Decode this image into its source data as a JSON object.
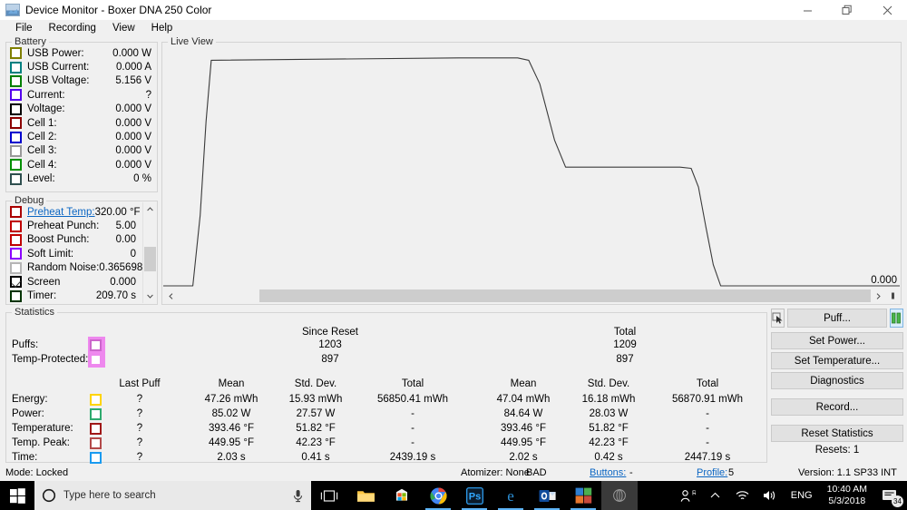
{
  "window": {
    "title": "Device Monitor - Boxer DNA 250 Color",
    "icon": "chart-app-icon",
    "controls": [
      {
        "name": "minimize",
        "glyph": "minimize-icon"
      },
      {
        "name": "maximize",
        "glyph": "restore-icon"
      },
      {
        "name": "close",
        "glyph": "close-icon"
      }
    ]
  },
  "menu": {
    "items": [
      "File",
      "Recording",
      "View",
      "Help"
    ]
  },
  "battery": {
    "legend": "Battery",
    "rows": [
      {
        "label": "USB Power:",
        "value": "0.000 W",
        "color": "#7f7f00",
        "checked": false
      },
      {
        "label": "USB Current:",
        "value": "0.000 A",
        "color": "#008080",
        "checked": false
      },
      {
        "label": "USB Voltage:",
        "value": "5.156 V",
        "color": "#008000",
        "checked": false
      },
      {
        "label": "Current:",
        "value": "?",
        "color": "#5500ee",
        "checked": false
      },
      {
        "label": "Voltage:",
        "value": "0.000 V",
        "color": "#000000",
        "checked": false
      },
      {
        "label": "Cell 1:",
        "value": "0.000 V",
        "color": "#8b0000",
        "checked": false
      },
      {
        "label": "Cell 2:",
        "value": "0.000 V",
        "color": "#0000cd",
        "checked": false
      },
      {
        "label": "Cell 3:",
        "value": "0.000 V",
        "color": "#9a9a9a",
        "checked": false
      },
      {
        "label": "Cell 4:",
        "value": "0.000 V",
        "color": "#009000",
        "checked": false
      },
      {
        "label": "Level:",
        "value": "0 %",
        "color": "#2f4f4f",
        "checked": false
      }
    ]
  },
  "debug": {
    "legend": "Debug",
    "rows": [
      {
        "label": "Preheat Temp:",
        "value": "320.00 °F",
        "color": "#aa0000",
        "checked": false,
        "link": true
      },
      {
        "label": "Preheat Punch:",
        "value": "5.00",
        "color": "#c00000",
        "checked": false,
        "link": false
      },
      {
        "label": "Boost Punch:",
        "value": "0.00",
        "color": "#c00000",
        "checked": false,
        "link": false
      },
      {
        "label": "Soft Limit:",
        "value": "0",
        "color": "#8b00ff",
        "checked": false,
        "link": false
      },
      {
        "label": "Random Noise:",
        "value": "0.365698",
        "color": "#b5b5b5",
        "checked": false,
        "link": false
      },
      {
        "label": "Screen",
        "value": "0.000",
        "color": "#000000",
        "checked": true,
        "link": false
      },
      {
        "label": "Timer:",
        "value": "209.70 s",
        "color": "#003300",
        "checked": false,
        "link": false
      }
    ],
    "scroll": {
      "up": "▲",
      "down": "▼"
    }
  },
  "liveview": {
    "legend": "Live View",
    "last_value": "0.000",
    "scroll": {
      "left": "‹",
      "right": "›",
      "end": "▮"
    }
  },
  "chart_data": {
    "type": "line",
    "title": "Live View",
    "xlabel": "",
    "ylabel": "",
    "ylim": [
      0,
      1
    ],
    "grid": false,
    "legend_position": "none",
    "annotations": [
      {
        "text": "0.000",
        "x": 1.0,
        "y": 0.0
      }
    ],
    "series": [
      {
        "name": "Voltage",
        "color": "#3a3a3a",
        "x": [
          0.0,
          0.04,
          0.05,
          0.058,
          0.065,
          0.4,
          0.48,
          0.495,
          0.51,
          0.53,
          0.545,
          0.7,
          0.715,
          0.725,
          0.735,
          0.745,
          0.755,
          1.0
        ],
        "y": [
          0.0,
          0.0,
          0.3,
          0.7,
          0.96,
          0.97,
          0.97,
          0.96,
          0.86,
          0.62,
          0.505,
          0.505,
          0.5,
          0.42,
          0.25,
          0.09,
          0.0,
          0.0
        ]
      }
    ]
  },
  "statistics": {
    "legend": "Statistics",
    "group_headers": [
      "Since Reset",
      "Total"
    ],
    "count_rows": [
      {
        "label": "Puffs:",
        "since_reset": "1203",
        "total": "1209",
        "color": "#cc66cc"
      },
      {
        "label": "Temp-Protected:",
        "since_reset": "897",
        "total": "897",
        "color": "#ee88ee"
      }
    ],
    "column_headers": [
      "Last Puff",
      "Mean",
      "Std. Dev.",
      "Total",
      "Mean",
      "Std. Dev.",
      "Total"
    ],
    "metric_rows": [
      {
        "label": "Energy:",
        "color": "#ffd400",
        "cells": [
          "?",
          "47.26 mWh",
          "15.93 mWh",
          "56850.41 mWh",
          "47.04 mWh",
          "16.18 mWh",
          "56870.91 mWh"
        ]
      },
      {
        "label": "Power:",
        "color": "#2eaa6e",
        "cells": [
          "?",
          "85.02 W",
          "27.57 W",
          "-",
          "84.64 W",
          "28.03 W",
          "-"
        ]
      },
      {
        "label": "Temperature:",
        "color": "#a01818",
        "cells": [
          "?",
          "393.46 °F",
          "51.82 °F",
          "-",
          "393.46 °F",
          "51.82 °F",
          "-"
        ]
      },
      {
        "label": "Temp. Peak:",
        "color": "#b34a4a",
        "cells": [
          "?",
          "449.95 °F",
          "42.23 °F",
          "-",
          "449.95 °F",
          "42.23 °F",
          "-"
        ]
      },
      {
        "label": "Time:",
        "color": "#1a9bf0",
        "cells": [
          "?",
          "2.03 s",
          "0.41 s",
          "2439.19 s",
          "2.02 s",
          "0.42 s",
          "2447.19 s"
        ]
      }
    ]
  },
  "actions": {
    "cursor_button": "pointer-select-icon",
    "puff": "Puff...",
    "battery_toggle": "battery-cells-icon",
    "set_power": "Set Power...",
    "set_temperature": "Set Temperature...",
    "diagnostics": "Diagnostics",
    "record": "Record...",
    "reset_statistics": "Reset Statistics",
    "resets": "Resets: 1"
  },
  "statusbar": {
    "mode": "Mode: Locked",
    "atomizer": "Atomizer: None",
    "atomizer_state": "BAD",
    "buttons_label": "Buttons:",
    "buttons_value": "-",
    "profile_label": "Profile:",
    "profile_value": "5",
    "version": "Version: 1.1 SP33 INT"
  },
  "taskbar": {
    "start": "windows-start-icon",
    "search_placeholder": "Type here to search",
    "mic": "microphone-icon",
    "task_view": "task-view-icon",
    "pinned": [
      {
        "name": "file-explorer-icon"
      },
      {
        "name": "microsoft-store-icon"
      },
      {
        "name": "google-chrome-icon"
      },
      {
        "name": "photoshop-icon"
      },
      {
        "name": "microsoft-edge-icon"
      },
      {
        "name": "outlook-icon"
      },
      {
        "name": "office-icon"
      },
      {
        "name": "device-monitor-icon"
      }
    ],
    "tray": {
      "people": "people-icon",
      "show_hidden": "show-hidden-icons-chevron",
      "network": "wifi-icon",
      "volume": "speaker-icon",
      "language": "ENG",
      "time": "10:40 AM",
      "date": "5/3/2018",
      "notifications": "action-center-icon",
      "notification_count": "34"
    }
  }
}
